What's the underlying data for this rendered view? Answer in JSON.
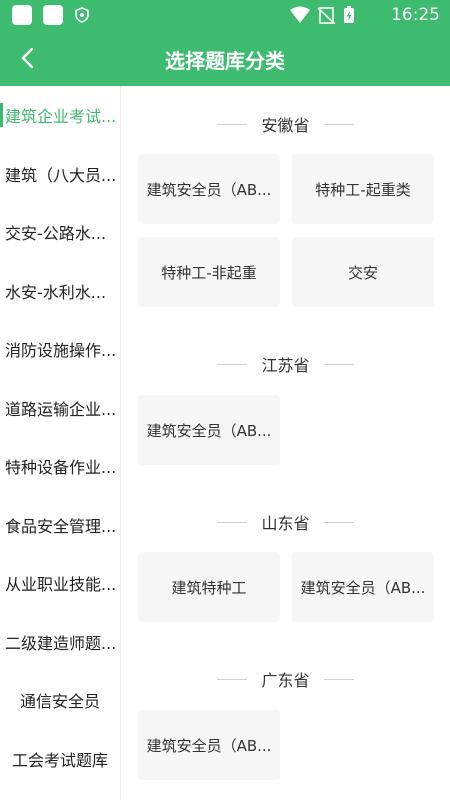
{
  "status_bar": {
    "time": "16:25"
  },
  "header": {
    "title": "选择题库分类"
  },
  "sidebar": {
    "items": [
      {
        "label": "建筑企业考试..."
      },
      {
        "label": "建筑（八大员..."
      },
      {
        "label": "交安-公路水..."
      },
      {
        "label": "水安-水利水..."
      },
      {
        "label": "消防设施操作..."
      },
      {
        "label": "道路运输企业..."
      },
      {
        "label": "特种设备作业..."
      },
      {
        "label": "食品安全管理..."
      },
      {
        "label": "从业职业技能..."
      },
      {
        "label": "二级建造师题..."
      },
      {
        "label": "通信安全员"
      },
      {
        "label": "工会考试题库"
      }
    ]
  },
  "main": {
    "provinces": [
      {
        "name": "安徽省",
        "cards": [
          "建筑安全员（AB...",
          "特种工-起重类",
          "特种工-非起重",
          "交安"
        ]
      },
      {
        "name": "江苏省",
        "cards": [
          "建筑安全员（AB..."
        ]
      },
      {
        "name": "山东省",
        "cards": [
          "建筑特种工",
          "建筑安全员（AB..."
        ]
      },
      {
        "name": "广东省",
        "cards": [
          "建筑安全员（AB..."
        ]
      }
    ]
  },
  "colors": {
    "accent": "#3dbb6f",
    "card_bg": "#f6f6f6"
  }
}
